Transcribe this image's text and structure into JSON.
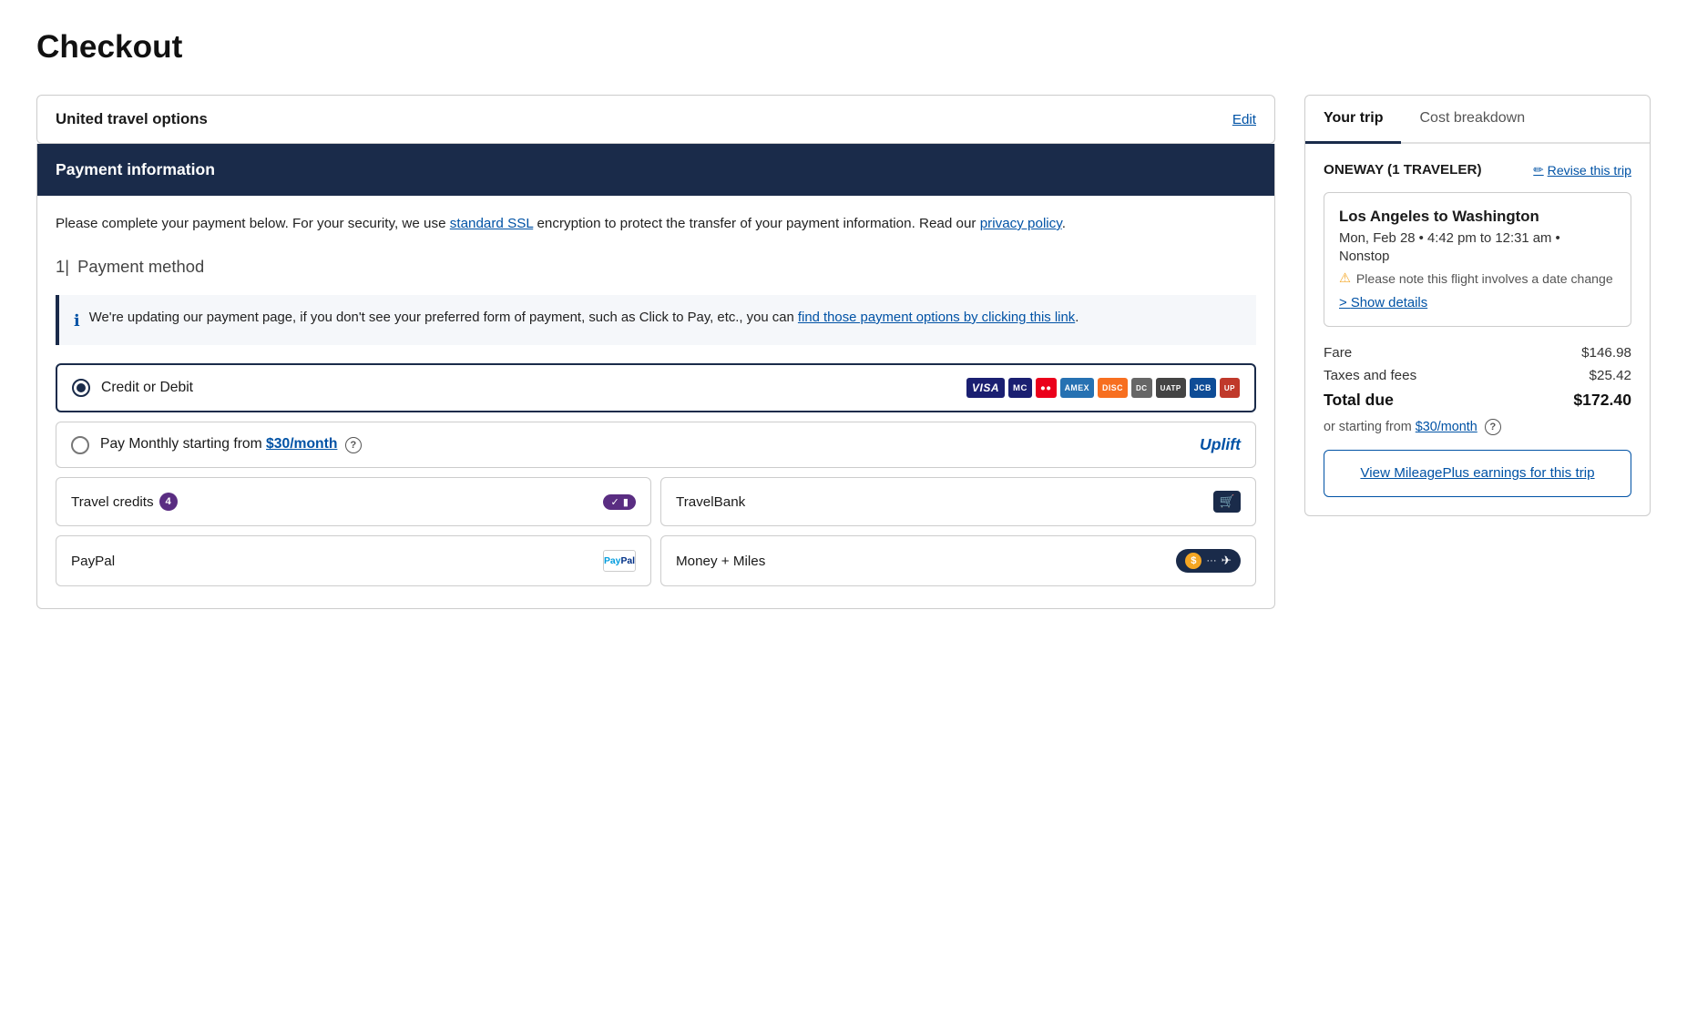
{
  "page": {
    "title": "Checkout"
  },
  "travel_options": {
    "label": "United travel options",
    "edit_label": "Edit"
  },
  "payment_info": {
    "header": "Payment information",
    "security_text_1": "Please complete your payment below. For your security, we use ",
    "ssl_link": "standard SSL",
    "security_text_2": " encryption to protect the transfer of your payment information. Read our ",
    "privacy_link": "privacy policy",
    "security_text_3": ".",
    "method_number": "1|",
    "method_title": "Payment method"
  },
  "info_banner": {
    "text_1": "We're updating our payment page, if you don't see your preferred form of payment, such as Click to Pay, etc., you can ",
    "link_text": "find those payment options by clicking this link",
    "text_2": "."
  },
  "payment_methods": {
    "credit_debit": {
      "label": "Credit or Debit",
      "selected": true
    },
    "pay_monthly": {
      "label": "Pay Monthly starting from ",
      "amount": "$30/month",
      "brand": "Uplift"
    },
    "travel_credits": {
      "label": "Travel credits",
      "badge": "4"
    },
    "travelbank": {
      "label": "TravelBank"
    },
    "paypal": {
      "label": "PayPal"
    },
    "money_miles": {
      "label": "Money + Miles"
    }
  },
  "sidebar": {
    "tabs": [
      {
        "label": "Your trip",
        "active": true
      },
      {
        "label": "Cost breakdown",
        "active": false
      }
    ],
    "trip": {
      "type_label": "ONEWAY (1 TRAVELER)",
      "revise_label": "Revise this trip",
      "route": "Los Angeles to Washington",
      "date_time": "Mon, Feb 28 • 4:42 pm to 12:31 am •",
      "stop": "Nonstop",
      "date_change_warning": "Please note this flight involves a date change",
      "show_details": "Show details",
      "fare_label": "Fare",
      "fare_value": "$146.98",
      "taxes_label": "Taxes and fees",
      "taxes_value": "$25.42",
      "total_label": "Total due",
      "total_value": "$172.40",
      "starting_from_label": "or starting from ",
      "starting_from_amount": "$30/month",
      "mileage_link": "View MileagePlus earnings for this trip"
    }
  }
}
